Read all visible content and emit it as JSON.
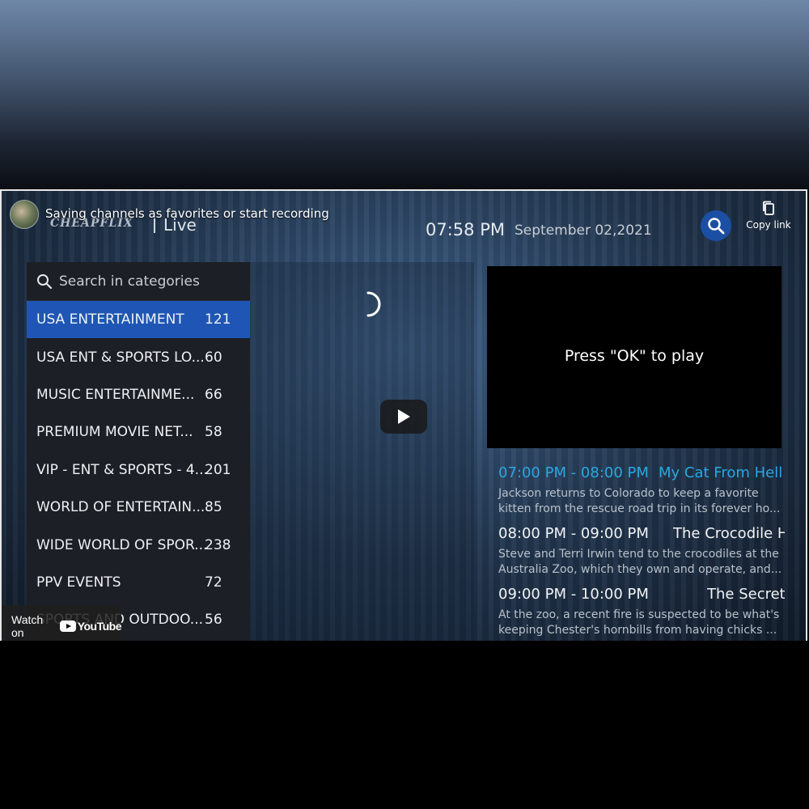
{
  "video": {
    "title": "Saving channels as favorites or start recording",
    "copy_link_label": "Copy link",
    "watch_on_label": "Watch on",
    "youtube_label": "YouTube"
  },
  "app": {
    "brand": "CHEAPFLIX",
    "section": "Live",
    "time": "07:58 PM",
    "date": "September 02,2021"
  },
  "categories": {
    "search_placeholder": "Search in categories",
    "items": [
      {
        "name": "USA ENTERTAINMENT",
        "count": "121"
      },
      {
        "name": "USA ENT & SPORTS LO...",
        "count": "60"
      },
      {
        "name": "MUSIC ENTERTAINME...",
        "count": "66"
      },
      {
        "name": "PREMIUM MOVIE NET...",
        "count": "58"
      },
      {
        "name": "VIP - ENT & SPORTS  - 4...",
        "count": "201"
      },
      {
        "name": "WORLD OF ENTERTAIN...",
        "count": "85"
      },
      {
        "name": "WIDE WORLD OF SPOR...",
        "count": "238"
      },
      {
        "name": "PPV EVENTS",
        "count": "72"
      },
      {
        "name": "SPORTS AND OUTDOO...",
        "count": "56"
      }
    ]
  },
  "preview": {
    "message": "Press \"OK\" to play"
  },
  "epg": [
    {
      "time": "07:00 PM - 08:00 PM",
      "title": "My Cat From Hell",
      "description_line1": "Jackson returns to Colorado to keep a favorite",
      "description_line2": "kitten from the rescue road trip in its forever ho..."
    },
    {
      "time": "08:00 PM - 09:00 PM",
      "title": "The Crocodile Hunter",
      "description_line1": "Steve and Terri Irwin tend to the crocodiles at the",
      "description_line2": "Australia Zoo, which they own and operate, and..."
    },
    {
      "time": "09:00 PM - 10:00 PM",
      "title": "The Secret Life of the Zoo",
      "description_line1": "At the zoo, a recent fire is suspected to be what's",
      "description_line2": "keeping Chester's hornbills from having chicks ..."
    }
  ],
  "colors": {
    "active_category": "#1f56b5",
    "current_program": "#2aa7e0",
    "search_button": "#1b4fa3"
  },
  "icons": {
    "search": "search-icon",
    "copy": "copy-icon",
    "play": "play-icon",
    "spinner": "loading-spinner-icon"
  }
}
